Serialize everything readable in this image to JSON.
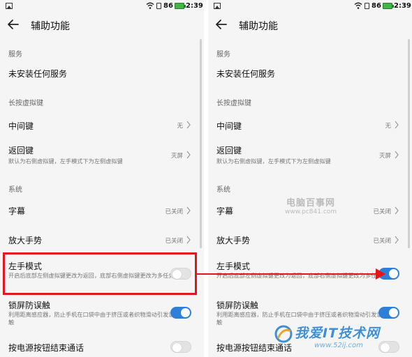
{
  "status_bar": {
    "battery_percent": "86",
    "time": "2:39",
    "battery_color": "#44b649"
  },
  "app_bar": {
    "title": "辅助功能"
  },
  "sections": {
    "services": "服务",
    "long_press": "长按虚拟键",
    "system": "系统"
  },
  "items": {
    "no_service": {
      "title": "未安装任何服务"
    },
    "middle_key": {
      "title": "中间键",
      "value": "无"
    },
    "back_key": {
      "title": "返回键",
      "value": "灭屏",
      "desc": "默认为右侧虚拟键，左手模式下为左侧虚拟键"
    },
    "subtitles": {
      "title": "字幕",
      "value": "已关闭"
    },
    "magnify": {
      "title": "放大手势",
      "value": "已关闭"
    },
    "left_hand": {
      "title": "左手模式",
      "desc": "开启后底部左侧虚拟键更改为返回，底部右侧虚拟键更改为多任务"
    },
    "lock_screen": {
      "title": "锁屏防误触",
      "desc": "利用距离感应器，防止手机在口袋中由于挤压或者织物滑动引发误触"
    },
    "power_end_call": {
      "title": "按电源按钮结束通话"
    }
  },
  "panels": {
    "left": {
      "left_hand_on": false,
      "lock_screen_on": true,
      "power_end_call_on": false
    },
    "right": {
      "left_hand_on": true,
      "lock_screen_on": true,
      "power_end_call_on": false
    }
  },
  "watermarks": {
    "pc841_main": "电脑百事网",
    "pc841_url": "www.pc841.com",
    "site_main": "我爱IT技术网",
    "site_url": "www.52ij.com"
  },
  "colors": {
    "toggle_on": "#2f7fd8",
    "annotation_red": "#e4161b",
    "background": "#f5f5f5"
  },
  "icons": {
    "back": "back-arrow-icon",
    "chevron": "chevron-right-icon",
    "wifi": "wifi-icon",
    "battery": "battery-icon"
  }
}
